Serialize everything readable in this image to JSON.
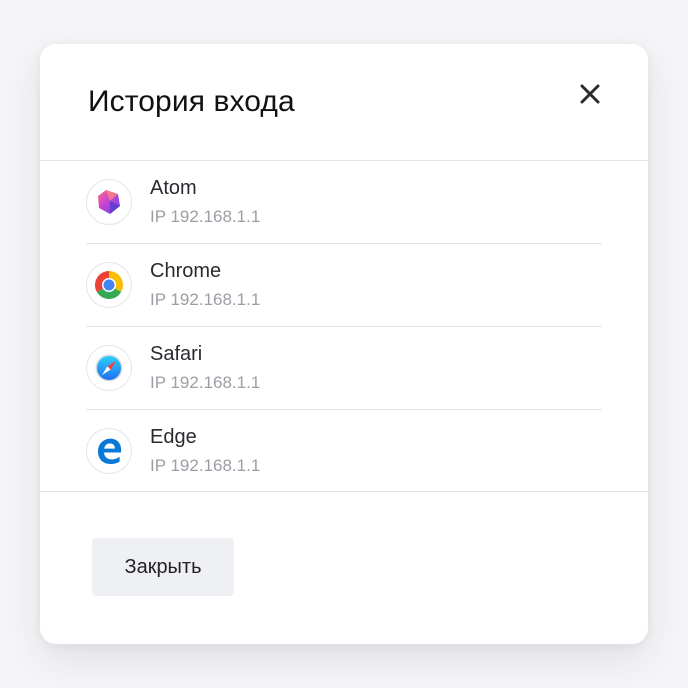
{
  "dialog": {
    "title": "История входа",
    "close_icon": "close-icon",
    "close_button_label": "Закрыть"
  },
  "sessions": [
    {
      "browser": "Atom",
      "ip": "IP 192.168.1.1",
      "icon": "atom-icon"
    },
    {
      "browser": "Chrome",
      "ip": "IP 192.168.1.1",
      "icon": "chrome-icon"
    },
    {
      "browser": "Safari",
      "ip": "IP 192.168.1.1",
      "icon": "safari-icon"
    },
    {
      "browser": "Edge",
      "ip": "IP 192.168.1.1",
      "icon": "edge-icon"
    }
  ],
  "colors": {
    "background": "#f5f5f7",
    "dialog": "#ffffff",
    "divider": "#e3e4e8",
    "title_text": "#111114",
    "secondary_text": "#9d9da5",
    "button_bg": "#eff0f4"
  }
}
